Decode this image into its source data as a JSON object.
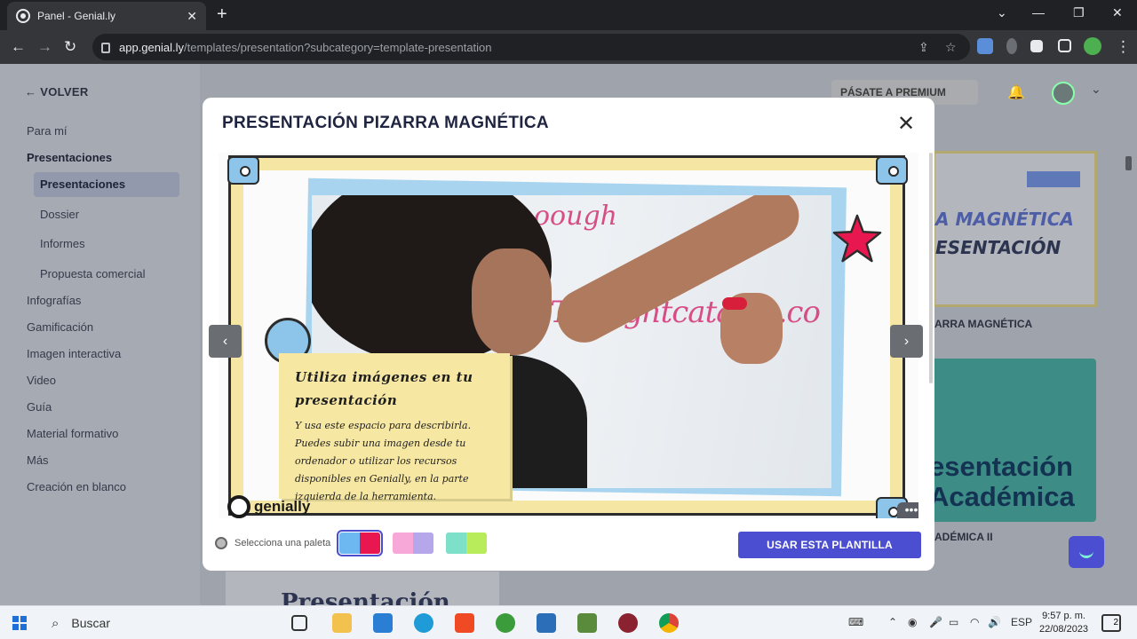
{
  "browser": {
    "tab_title": "Panel - Genial.ly",
    "tab_close": "✕",
    "new_tab": "+",
    "url_host": "app.genial.ly",
    "url_path": "/templates/presentation?subcategory=template-presentation"
  },
  "sidebar": {
    "back_label": "VOLVER",
    "items": [
      {
        "label": "Para mí"
      },
      {
        "label": "Presentaciones"
      },
      {
        "label": "Presentaciones"
      },
      {
        "label": "Dossier"
      },
      {
        "label": "Informes"
      },
      {
        "label": "Propuesta comercial"
      },
      {
        "label": "Infografías"
      },
      {
        "label": "Gamificación"
      },
      {
        "label": "Imagen interactiva"
      },
      {
        "label": "Video"
      },
      {
        "label": "Guía"
      },
      {
        "label": "Material formativo"
      },
      {
        "label": "Más"
      },
      {
        "label": "Creación en blanco"
      }
    ]
  },
  "header": {
    "premium_label": "PÁSATE A PREMIUM"
  },
  "background_cards": {
    "card1_line1": "A MAGNÉTICA",
    "card1_line2": "ESENTACIÓN",
    "card1_label": "ARRA MAGNÉTICA",
    "card2_line1": "esentación",
    "card2_line2": "Académica",
    "card2_label": "ADÉMICA II",
    "bottom_card_text": "Presentación"
  },
  "modal": {
    "title": "PRESENTACIÓN PIZARRA MAGNÉTICA",
    "slide": {
      "note_title": "Utiliza imágenes en tu presentación",
      "note_body": "Y usa este espacio para describirla. Puedes subir una imagen desde tu ordenador o utilizar los recursos disponibles en Genially, en la parte izquierda de la herramienta.",
      "board_writing": "Thoughtcatalog.co",
      "board_writing_top": "oough",
      "logo_text": "genially",
      "more": "•••"
    },
    "palette_label": "Selecciona una paleta",
    "palettes": [
      {
        "colors": [
          "#6db8f0",
          "#e8174f"
        ],
        "selected": true
      },
      {
        "colors": [
          "#f7a8d8",
          "#b6a6ea"
        ],
        "selected": false
      },
      {
        "colors": [
          "#7ee0c8",
          "#b8ec5a"
        ],
        "selected": false
      }
    ],
    "use_button": "USAR ESTA PLANTILLA",
    "prev": "‹",
    "next": "›"
  },
  "taskbar": {
    "search_label": "Buscar",
    "language": "ESP",
    "time": "9:57 p. m.",
    "date": "22/08/2023",
    "notifications": "2"
  },
  "colors": {
    "accent": "#4b4ed0",
    "frame_yellow": "#f5e6a4",
    "frame_blue": "#8cc4ea",
    "star_pink": "#e8174f"
  }
}
